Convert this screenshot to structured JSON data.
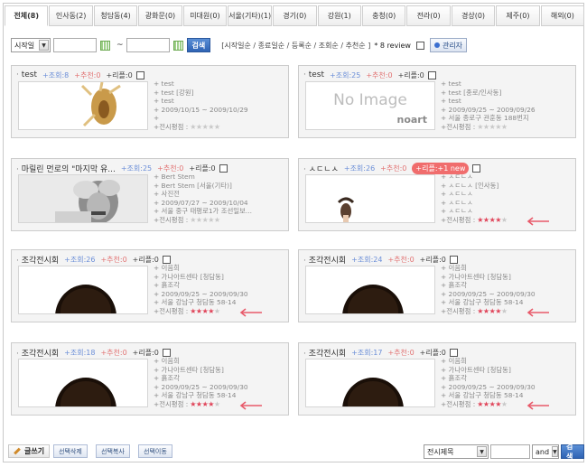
{
  "tabs": [
    {
      "label": "전체(8)",
      "active": true
    },
    {
      "label": "인사동(2)",
      "active": false
    },
    {
      "label": "청담동(4)",
      "active": false
    },
    {
      "label": "광화문(0)",
      "active": false
    },
    {
      "label": "미대원(0)",
      "active": false
    },
    {
      "label": "서울(기타)(1)",
      "active": false
    },
    {
      "label": "경기(0)",
      "active": false
    },
    {
      "label": "강원(1)",
      "active": false
    },
    {
      "label": "충청(0)",
      "active": false
    },
    {
      "label": "전라(0)",
      "active": false
    },
    {
      "label": "경상(0)",
      "active": false
    },
    {
      "label": "제주(0)",
      "active": false
    },
    {
      "label": "해외(0)",
      "active": false
    }
  ],
  "filter": {
    "date_select": "시작일",
    "tilde": "~",
    "search_button": "검색",
    "sort_options": "[시작일순 / 종료일순 / 등록순 / 조회순 / 추천순 ]",
    "review_count": "* 8 review",
    "admin_button": "관리자"
  },
  "cards": [
    {
      "title": "test",
      "views": "+조회:8",
      "recommend": "+추천:0",
      "reply": "+리플:0",
      "reply_badge": "",
      "thumb": "dark",
      "no_image_label": "",
      "no_image_brand": "",
      "lines": [
        "+ test",
        "+ test [강원]",
        "+ test",
        "+ 2009/10/15 ~ 2009/10/29",
        "+"
      ],
      "rating_label": "+전시평점 :",
      "stars": 0,
      "arrow": false
    },
    {
      "title": "test",
      "views": "+조회:25",
      "recommend": "+추천:0",
      "reply": "+리플:0",
      "reply_badge": "",
      "thumb": "noimage",
      "no_image_label": "No Image",
      "no_image_brand": "noart",
      "lines": [
        "+ test",
        "+ test [종로/인사동]",
        "+ test",
        "+ 2009/09/25 ~ 2009/09/26",
        "+ 서울 종로구 관훈동 188번지"
      ],
      "rating_label": "+전시평점 :",
      "stars": 0,
      "arrow": false
    },
    {
      "title": "마릴린 먼로의 \"마지막 유...",
      "views": "+조회:25",
      "recommend": "+추천:0",
      "reply": "+리플:0",
      "reply_badge": "",
      "thumb": "monroe",
      "no_image_label": "",
      "no_image_brand": "",
      "lines": [
        "+ Bert Stem",
        "+ Bert Stem [서울(기타)]",
        "+ 사진전",
        "+ 2009/07/27 ~ 2009/10/04",
        "+ 서울 중구 태평로1가 조선일보..."
      ],
      "rating_label": "+전시평점 :",
      "stars": 0,
      "arrow": false
    },
    {
      "title": "ㅅㄷㄴㅅ",
      "views": "+조회:26",
      "recommend": "+추천:0",
      "reply": "",
      "reply_badge": "+리플:+1 new",
      "thumb": "sky_woman",
      "no_image_label": "",
      "no_image_brand": "",
      "lines": [
        "+ ㅅㄷㄴㅅ",
        "+ ㅅㄷㄴㅅ [인사동]",
        "+ ㅅㄷㄴㅅ",
        "+ ㅅㄷㄴㅅ",
        "+ ㅅㄷㄴㅅ"
      ],
      "rating_label": "+전시평점 :",
      "stars": 4,
      "arrow": true
    },
    {
      "title": "조각전시회",
      "views": "+조회:26",
      "recommend": "+추천:0",
      "reply": "+리플:0",
      "reply_badge": "",
      "thumb": "sky_head",
      "no_image_label": "",
      "no_image_brand": "",
      "lines": [
        "+ 이음희",
        "+ 가나아트센타 [청담동]",
        "+ 흙조각",
        "+ 2009/09/25 ~ 2009/09/30",
        "+ 서울 강남구 청담동 58-14"
      ],
      "rating_label": "+전시평점 :",
      "stars": 4,
      "arrow": true
    },
    {
      "title": "조각전시회",
      "views": "+조회:24",
      "recommend": "+추천:0",
      "reply": "+리플:0",
      "reply_badge": "",
      "thumb": "sky_head",
      "no_image_label": "",
      "no_image_brand": "",
      "lines": [
        "+ 이음희",
        "+ 가나아트센타 [청담동]",
        "+ 흙조각",
        "+ 2009/09/25 ~ 2009/09/30",
        "+ 서울 강남구 청담동 58-14"
      ],
      "rating_label": "+전시평점 :",
      "stars": 4,
      "arrow": true
    },
    {
      "title": "조각전시회",
      "views": "+조회:18",
      "recommend": "+추천:0",
      "reply": "+리플:0",
      "reply_badge": "",
      "thumb": "sky_head",
      "no_image_label": "",
      "no_image_brand": "",
      "lines": [
        "+ 이음희",
        "+ 가나아트센타 [청담동]",
        "+ 흙조각",
        "+ 2009/09/25 ~ 2009/09/30",
        "+ 서울 강남구 청담동 58-14"
      ],
      "rating_label": "+전시평점 :",
      "stars": 4,
      "arrow": true
    },
    {
      "title": "조각전시회",
      "views": "+조회:17",
      "recommend": "+추천:0",
      "reply": "+리플:0",
      "reply_badge": "",
      "thumb": "sky_head",
      "no_image_label": "",
      "no_image_brand": "",
      "lines": [
        "+ 이음희",
        "+ 가나아트센타 [청담동]",
        "+ 흙조각",
        "+ 2009/09/25 ~ 2009/09/30",
        "+ 서울 강남구 청담동 58-14"
      ],
      "rating_label": "+전시평점 :",
      "stars": 4,
      "arrow": true
    }
  ],
  "bottom": {
    "write_button": "글쓰기",
    "delete_button": "선택삭제",
    "copy_button": "선택복사",
    "move_button": "선택이동",
    "search_field_select": "전시제목",
    "logic_select": "and",
    "search_button": "검색"
  },
  "colors": {
    "views": "#6c8fd8",
    "recommend": "#e27474",
    "star_on": "#e0455a",
    "arrow": "#e85a6a",
    "button_blue": "#2e63b4"
  }
}
